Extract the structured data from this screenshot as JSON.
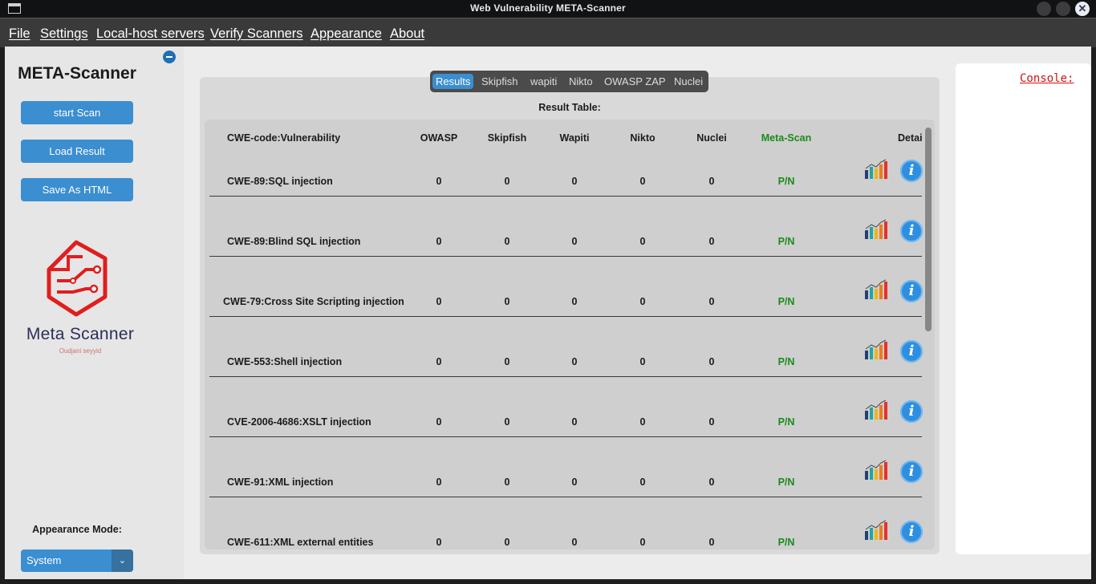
{
  "window": {
    "title": "Web Vulnerability META-Scanner"
  },
  "menu": {
    "file": "File",
    "settings": "Settings",
    "localhost": "Local-host servers",
    "verify": "Verify Scanners",
    "appearance": "Appearance",
    "about": "About"
  },
  "sidebar": {
    "brand": "META-Scanner",
    "start_scan": "start Scan",
    "load_result": "Load Result",
    "save_html": "Save As HTML",
    "logo_text": "Meta Scanner",
    "logo_sub": "Oudjani seyyid",
    "appearance_label": "Appearance Mode:",
    "appearance_value": "System"
  },
  "tabs": [
    "Results",
    "Skipfish",
    "wapiti",
    "Nikto",
    "OWASP ZAP",
    "Nuclei"
  ],
  "result_title": "Result Table:",
  "table": {
    "headers": {
      "vuln": "CWE-code:Vulnerability",
      "owasp": "OWASP",
      "skipfish": "Skipfish",
      "wapiti": "Wapiti",
      "nikto": "Nikto",
      "nuclei": "Nuclei",
      "meta": "Meta-Scan",
      "detail": "Detai"
    },
    "rows": [
      {
        "vuln": "CWE-89:SQL injection",
        "owasp": "0",
        "skipfish": "0",
        "wapiti": "0",
        "nikto": "0",
        "nuclei": "0",
        "meta": "P/N"
      },
      {
        "vuln": "CWE-89:Blind SQL injection",
        "owasp": "0",
        "skipfish": "0",
        "wapiti": "0",
        "nikto": "0",
        "nuclei": "0",
        "meta": "P/N"
      },
      {
        "vuln": "CWE-79:Cross Site Scripting injection",
        "owasp": "0",
        "skipfish": "0",
        "wapiti": "0",
        "nikto": "0",
        "nuclei": "0",
        "meta": "P/N"
      },
      {
        "vuln": "CWE-553:Shell injection",
        "owasp": "0",
        "skipfish": "0",
        "wapiti": "0",
        "nikto": "0",
        "nuclei": "0",
        "meta": "P/N"
      },
      {
        "vuln": "CVE-2006-4686:XSLT injection",
        "owasp": "0",
        "skipfish": "0",
        "wapiti": "0",
        "nikto": "0",
        "nuclei": "0",
        "meta": "P/N"
      },
      {
        "vuln": "CWE-91:XML injection",
        "owasp": "0",
        "skipfish": "0",
        "wapiti": "0",
        "nikto": "0",
        "nuclei": "0",
        "meta": "P/N"
      },
      {
        "vuln": "CWE-611:XML external entities",
        "owasp": "0",
        "skipfish": "0",
        "wapiti": "0",
        "nikto": "0",
        "nuclei": "0",
        "meta": "P/N"
      }
    ]
  },
  "console": {
    "label": "Console:"
  },
  "colors": {
    "accent": "#3b8ed0",
    "meta_green": "#1a8a1a",
    "console_red": "#d11010"
  }
}
